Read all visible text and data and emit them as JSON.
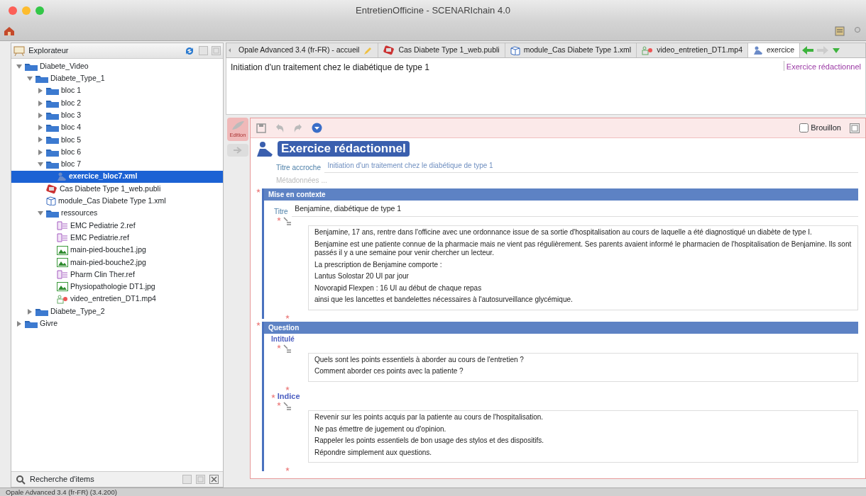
{
  "window": {
    "title": "EntretienOfficine - SCENARIchain 4.0"
  },
  "explorer": {
    "title": "Explorateur",
    "tree": [
      {
        "label": "Diabete_Video",
        "kind": "folder",
        "expanded": true,
        "selected": false,
        "children": [
          {
            "label": "Diabete_Type_1",
            "kind": "folder",
            "expanded": true,
            "selected": false,
            "children": [
              {
                "label": "bloc 1",
                "kind": "folder",
                "expanded": false,
                "selected": false
              },
              {
                "label": "bloc 2",
                "kind": "folder",
                "expanded": false,
                "selected": false
              },
              {
                "label": "bloc 3",
                "kind": "folder",
                "expanded": false,
                "selected": false
              },
              {
                "label": "bloc 4",
                "kind": "folder",
                "expanded": false,
                "selected": false
              },
              {
                "label": "bloc 5",
                "kind": "folder",
                "expanded": false,
                "selected": false
              },
              {
                "label": "bloc 6",
                "kind": "folder",
                "expanded": false,
                "selected": false
              },
              {
                "label": "bloc 7",
                "kind": "folder",
                "expanded": true,
                "selected": false,
                "children": [
                  {
                    "label": "exercice_bloc7.xml",
                    "kind": "exercise",
                    "selected": true
                  }
                ]
              },
              {
                "label": "Cas Diabete Type 1_web.publi",
                "kind": "publi",
                "selected": false
              },
              {
                "label": "module_Cas Diabete Type 1.xml",
                "kind": "module",
                "selected": false
              },
              {
                "label": "ressources",
                "kind": "folder",
                "expanded": true,
                "selected": false,
                "children": [
                  {
                    "label": "EMC Pediatrie 2.ref",
                    "kind": "ref",
                    "selected": false
                  },
                  {
                    "label": "EMC Pediatrie.ref",
                    "kind": "ref",
                    "selected": false
                  },
                  {
                    "label": "main-pied-bouche1.jpg",
                    "kind": "image",
                    "selected": false
                  },
                  {
                    "label": "main-pied-bouche2.jpg",
                    "kind": "image",
                    "selected": false
                  },
                  {
                    "label": "Pharm Clin Ther.ref",
                    "kind": "ref",
                    "selected": false
                  },
                  {
                    "label": "Physiopathologie DT1.jpg",
                    "kind": "image",
                    "selected": false
                  },
                  {
                    "label": "video_entretien_DT1.mp4",
                    "kind": "video",
                    "selected": false
                  }
                ]
              }
            ]
          },
          {
            "label": "Diabete_Type_2",
            "kind": "folder",
            "expanded": false,
            "selected": false
          }
        ]
      },
      {
        "label": "Givre",
        "kind": "folder",
        "expanded": false,
        "selected": false
      }
    ],
    "search_title": "Recherche d'items"
  },
  "tabs": [
    {
      "label": "Opale Advanced 3.4 (fr-FR) - accueil",
      "kind": "home",
      "selected": false
    },
    {
      "label": "Cas Diabete Type 1_web.publi",
      "kind": "publi",
      "selected": false
    },
    {
      "label": "module_Cas Diabete Type 1.xml",
      "kind": "module",
      "selected": false
    },
    {
      "label": "video_entretien_DT1.mp4",
      "kind": "video",
      "selected": false
    },
    {
      "label": "exercice",
      "kind": "exercise",
      "selected": true
    }
  ],
  "item_title": {
    "value": "Initiation d'un traitement chez le diabétique de type 1",
    "type_label": "Exercice rédactionnel"
  },
  "editor": {
    "side_tabs": [
      {
        "kind": "edit",
        "label": "Edition",
        "selected": true
      },
      {
        "kind": "preview",
        "selected": false
      }
    ],
    "draft": {
      "label": "Brouillon",
      "checked": false
    },
    "heading": "Exercice rédactionnel",
    "hook_title": {
      "label": "Titre accroche",
      "value": "Initiation d'un traitement chez le diabétique de type 1"
    },
    "metadata": "Métadonnées ...",
    "sections": [
      {
        "title": "Mise en contexte",
        "field": {
          "label": "Titre",
          "value": "Benjamine, diabétique de type 1"
        },
        "blocks": [
          {
            "paragraphs": [
              "Benjamine, 17 ans, rentre dans l'officine avec une ordonnance issue de sa sortie d'hospitalisation au cours de laquelle a été diagnostiqué un diabète de type I.",
              "Benjamine est une patiente connue de la pharmacie mais ne vient pas régulièrement. Ses parents avaient informé le pharmacien de l'hospitalisation de Benjamine. Ils sont passés il y a une semaine pour venir chercher un lecteur.",
              "La prescription de Benjamine comporte :",
              "Lantus Solostar 20 UI par jour",
              "Novorapid Flexpen : 16 UI au début de chaque repas",
              "ainsi que les lancettes et bandelettes nécessaires à l'autosurveillance glycémique."
            ]
          }
        ]
      },
      {
        "title": "Question",
        "blocks": [
          {
            "label": "Intitulé",
            "paragraphs": [
              "Quels sont les points essentiels à aborder au cours de l'entretien ?",
              "Comment aborder ces points avec la patiente ?"
            ]
          },
          {
            "label": "Indice",
            "paragraphs": [
              "Revenir sur les points acquis par la patiente au cours de l'hospitalisation.",
              "Ne pas émettre de jugement ou d'opinion.",
              "Rappeler les points essentiels de bon usage des stylos et des dispositifs.",
              "Répondre simplement aux questions."
            ]
          }
        ]
      }
    ]
  },
  "status_bar": "Opale Advanced 3.4 (fr-FR) (3.4.200)"
}
